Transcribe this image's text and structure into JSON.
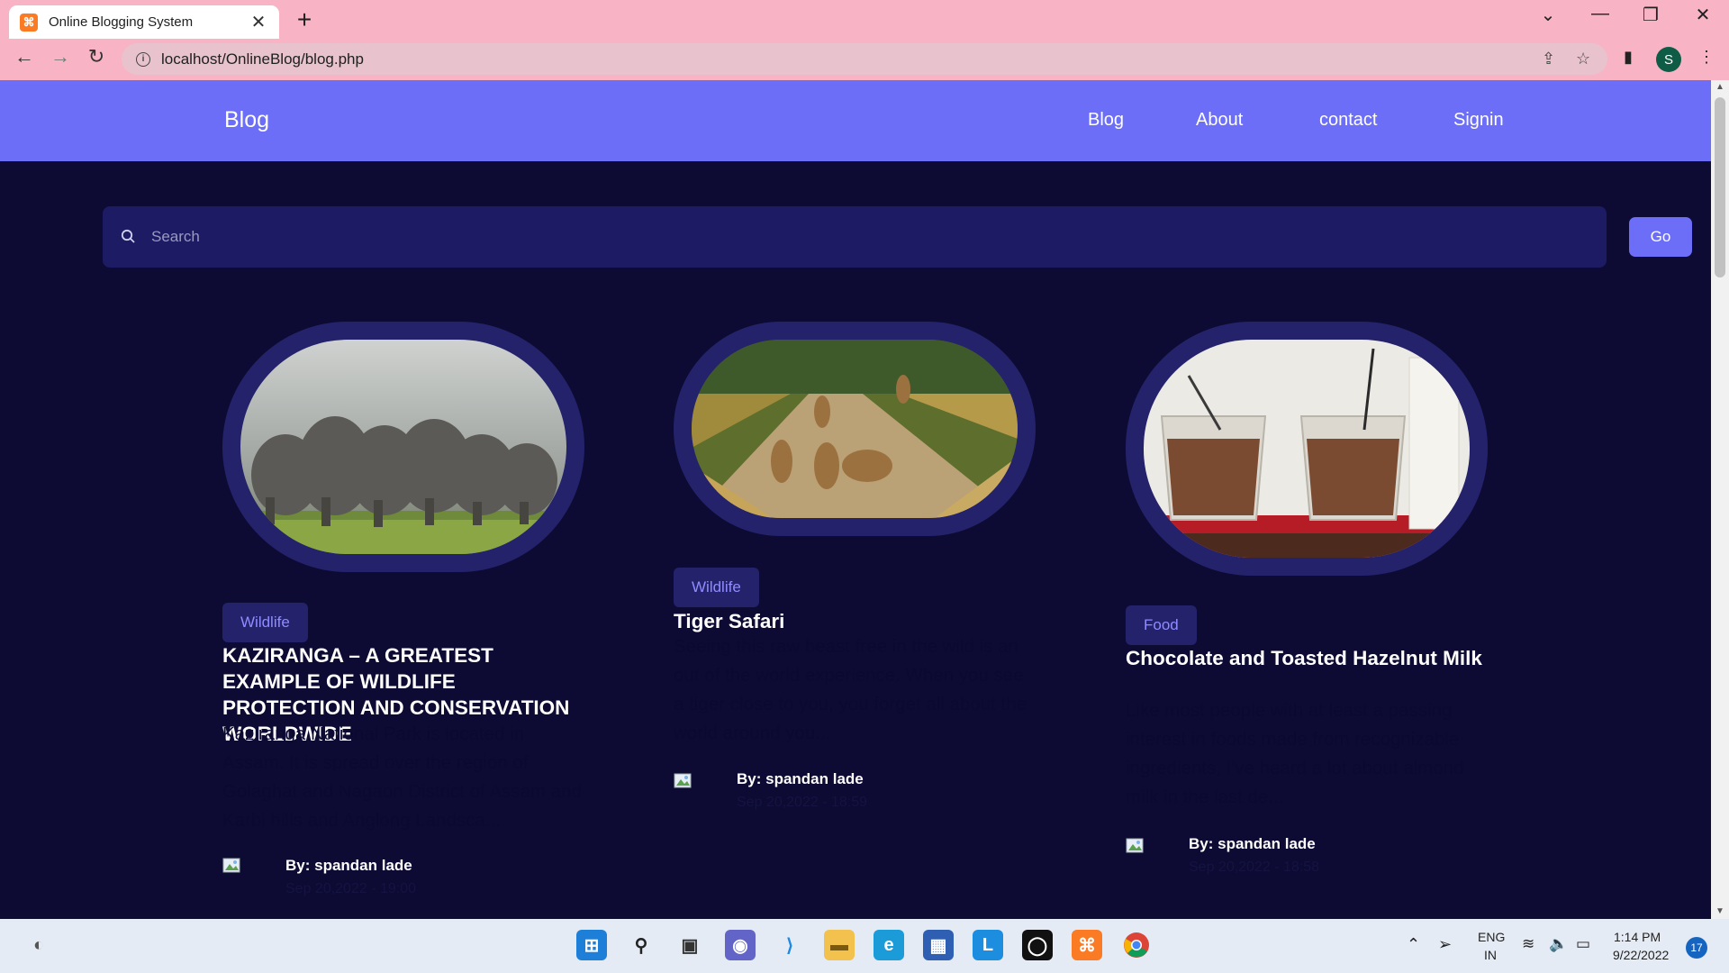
{
  "browser": {
    "tab_title": "Online Blogging System",
    "tab_close": "✕",
    "new_tab": "+",
    "url": "localhost/OnlineBlog/blog.php",
    "profile_initial": "S",
    "window_controls": {
      "dropdown": "⌄",
      "minimize": "—",
      "restore": "❐",
      "close": "✕"
    }
  },
  "header": {
    "brand": "Blog",
    "nav": [
      "Blog",
      "About",
      "contact",
      "Signin"
    ]
  },
  "search": {
    "placeholder": "Search",
    "button": "Go"
  },
  "posts": [
    {
      "category": "Wildlife",
      "title": "KAZIRANGA – A GREATEST EXAMPLE OF WILDLIFE PROTECTION AND CONSERVATION WORLDWIDE",
      "excerpt": "Kaziranga National Park is located in Assam. It is spread over the region of Golaghat and Nagaon District of Assam and Karbi hills and Anglong Landsca...",
      "author": "By: spandan lade",
      "date": "Sep 20,2022 - 19:00",
      "image": "elephants-photo"
    },
    {
      "category": "Wildlife",
      "title": "Tiger Safari",
      "excerpt": "Seeing this raw beast free in the wild is an out of the world experience. When you see a tiger close to you, you forget all about the world around you...",
      "author": "By: spandan lade",
      "date": "Sep 20,2022 - 18:59",
      "image": "lions-on-road-photo"
    },
    {
      "category": "Food",
      "title": "Chocolate and Toasted Hazelnut Milk",
      "excerpt": "Like most people with at least a passing interest in foods made from recognizable ingredients, I've heard a lot about almond milk in the last de...",
      "author": "By: spandan lade",
      "date": "Sep 20,2022 - 18:58",
      "image": "chocolate-milk-glasses-photo"
    }
  ],
  "taskbar": {
    "language": "ENG",
    "region": "IN",
    "time": "1:14 PM",
    "date": "9/22/2022",
    "notifications": "17"
  }
}
